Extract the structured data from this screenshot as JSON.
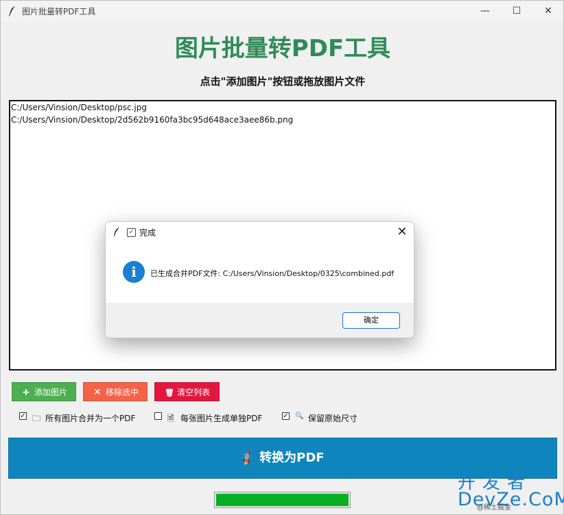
{
  "window": {
    "title": "图片批量转PDF工具",
    "minimize_glyph": "—",
    "maximize_glyph": "☐",
    "close_glyph": "✕",
    "icon": "feather-icon"
  },
  "header": {
    "title": "图片批量转PDF工具",
    "subtitle": "点击\"添加图片\"按钮或拖放图片文件"
  },
  "file_list": {
    "items": [
      "C:/Users/Vinsion/Desktop/psc.jpg",
      "C:/Users/Vinsion/Desktop/2d562b9160fa3bc95d648ace3aee86b.png"
    ]
  },
  "buttons": {
    "add": {
      "label": "添加图片",
      "icon": "plus-icon",
      "glyph": "+",
      "color": "#4caf50"
    },
    "remove": {
      "label": "移除选中",
      "icon": "x-icon",
      "glyph": "✕",
      "color": "#f4624a"
    },
    "clear": {
      "label": "清空列表",
      "icon": "trash-icon",
      "glyph": "🗑",
      "color": "#e3173e"
    }
  },
  "options": [
    {
      "label": "所有图片合并为一个PDF",
      "checked": true,
      "check_glyph": "✓",
      "icon": "folder-icon",
      "glyph": "🗀"
    },
    {
      "label": "每张图片生成单独PDF",
      "checked": false,
      "check_glyph": "",
      "icon": "document-icon",
      "glyph": "🗎"
    },
    {
      "label": "保留原始尺寸",
      "checked": true,
      "check_glyph": "✓",
      "icon": "magnifier-icon",
      "glyph": "🔍"
    }
  ],
  "convert": {
    "label": "转换为PDF",
    "icon": "rocket-icon",
    "glyph": "🚀",
    "color": "#0f85bd"
  },
  "progress": {
    "value": 1.0,
    "color": "#06b025"
  },
  "dialog": {
    "title": "完成",
    "check_glyph": "✓",
    "message": "已生成合并PDF文件: C:/Users/Vinsion/Desktop/0325\\combined.pdf",
    "ok_label": "确定",
    "info_glyph": "i",
    "close_glyph": "✕"
  },
  "watermark": {
    "top": "开发者",
    "bottom": "DevZe.CoM",
    "small": "@稀土掘金"
  },
  "colors": {
    "title_green": "#2e8b57",
    "background": "#f0f0f0"
  }
}
